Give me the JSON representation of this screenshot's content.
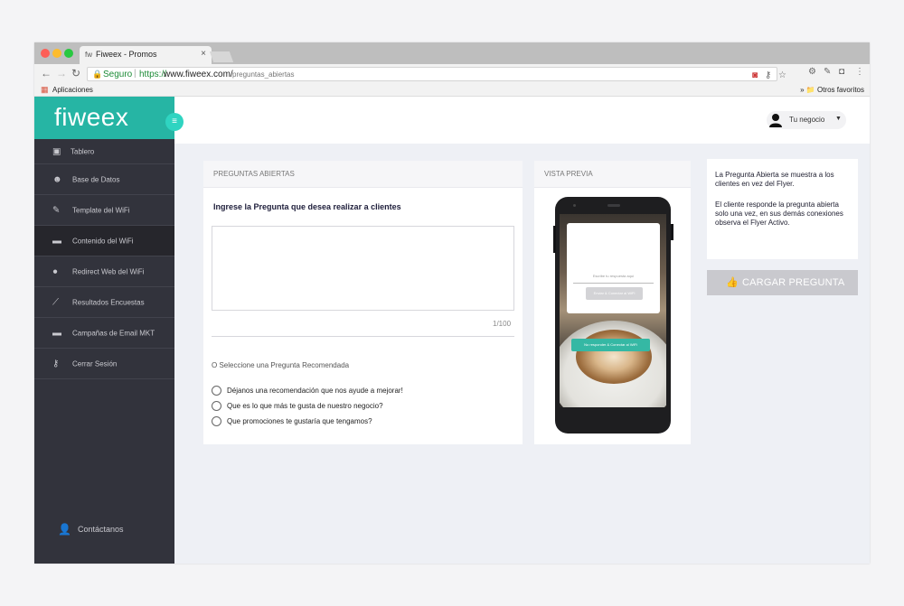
{
  "browser": {
    "tab_title": "Fiweex - Promos",
    "tab_favicon": "fw",
    "tab_close": "×",
    "secure_label": "Seguro",
    "url_protocol": "https://",
    "url_host": "www.fiweex.com/",
    "url_path": "preguntas_abiertas",
    "apps_label": "Aplicaciones",
    "other_bookmarks": "» 📁 Otros favoritos"
  },
  "brand": {
    "logo": "fiweex",
    "color": "#26b5a4",
    "accent": "#2fd4c1"
  },
  "sidebar": {
    "items": [
      {
        "label": "Tablero",
        "icon": "dashboard-icon"
      },
      {
        "label": "Base de Datos",
        "icon": "users-icon"
      },
      {
        "label": "Template del WiFi",
        "icon": "pencil-icon"
      },
      {
        "label": "Contenido del WiFi",
        "icon": "archive-icon"
      },
      {
        "label": "Redirect Web del WiFi",
        "icon": "globe-icon"
      },
      {
        "label": "Resultados Encuestas",
        "icon": "chart-icon"
      },
      {
        "label": "Campañas de Email MKT",
        "icon": "archive-icon"
      },
      {
        "label": "Cerrar Sesión",
        "icon": "key-icon"
      }
    ],
    "active_index": 3,
    "contact_label": "Contáctanos"
  },
  "topbar": {
    "user_label": "Tu negocio"
  },
  "questions_panel": {
    "title": "PREGUNTAS ABIERTAS",
    "prompt": "Ingrese la Pregunta que desea realizar a clientes",
    "input_value": "",
    "counter": "1/100",
    "suggest_label": "O Seleccione una Pregunta Recomendada",
    "options": [
      "Déjanos una recomendación que nos ayude a mejorar!",
      "Que es lo que más te gusta de nuestro negocio?",
      "Que promociones te gustaría que tengamos?"
    ]
  },
  "preview_panel": {
    "title": "VISTA PREVIA",
    "card_hint": "Escribe tu respuesta aquí",
    "card_button": "Enviar & Conectar al WiFi",
    "screen_button": "No responder & Conectar al WiFi"
  },
  "info_panel": {
    "paragraph_1": "La Pregunta Abierta se muestra a los clientes en vez del Flyer.",
    "paragraph_2": "El cliente responde la pregunta abierta solo una vez, en sus demás conexiones observa el Flyer Activo."
  },
  "upload_button": {
    "label": "CARGAR PREGUNTA"
  }
}
